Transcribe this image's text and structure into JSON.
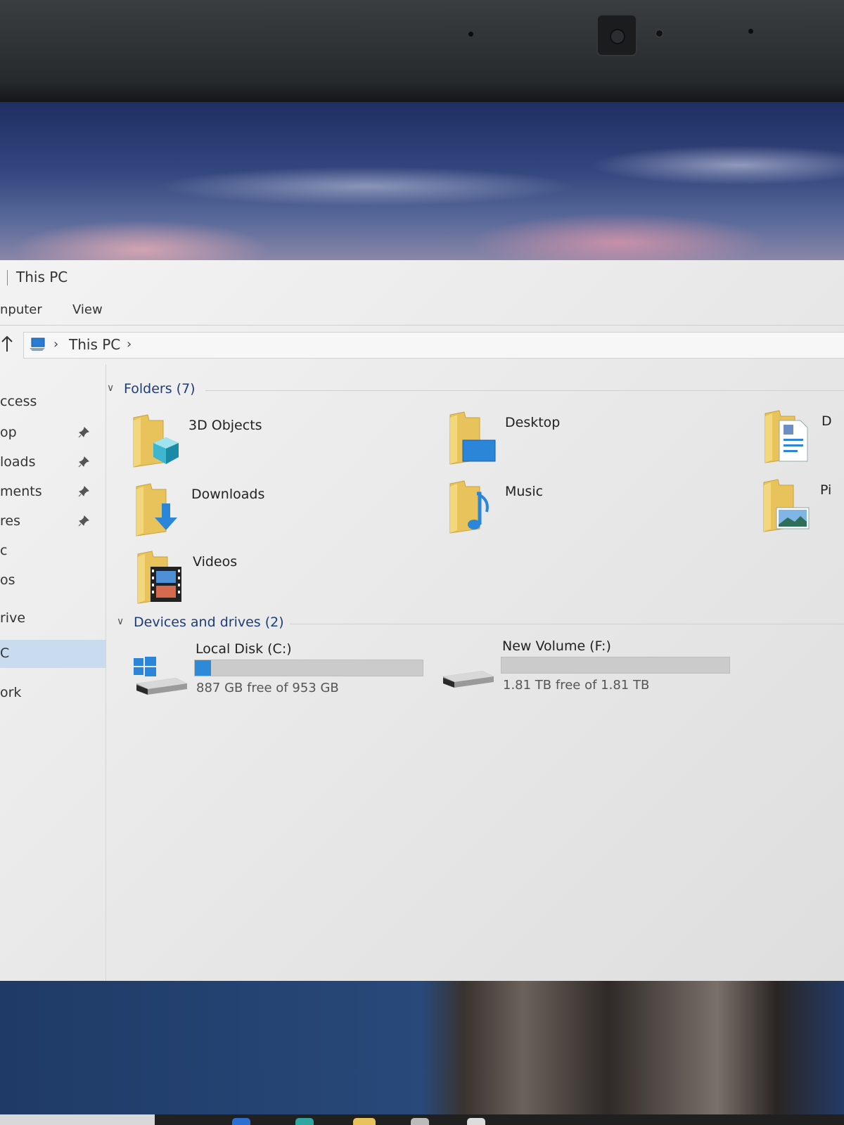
{
  "window": {
    "title": "This PC"
  },
  "ribbon": {
    "tab_computer": "nputer",
    "tab_view": "View"
  },
  "address": {
    "crumb": "This PC",
    "sep1": "›",
    "sep2": "›"
  },
  "nav": {
    "items": [
      {
        "label": "ccess"
      },
      {
        "label": "op",
        "pinned": true
      },
      {
        "label": "loads",
        "pinned": true
      },
      {
        "label": "ments",
        "pinned": true
      },
      {
        "label": "res",
        "pinned": true
      },
      {
        "label": "c"
      },
      {
        "label": "os"
      },
      {
        "label": "rive"
      },
      {
        "label": "C",
        "selected": true
      },
      {
        "label": "ork"
      }
    ]
  },
  "folders": {
    "header": "Folders (7)",
    "items": [
      {
        "label": "3D Objects",
        "icon": "3d-objects-folder-icon"
      },
      {
        "label": "Desktop",
        "icon": "desktop-folder-icon"
      },
      {
        "label": "D",
        "icon": "documents-folder-icon"
      },
      {
        "label": "Downloads",
        "icon": "downloads-folder-icon"
      },
      {
        "label": "Music",
        "icon": "music-folder-icon"
      },
      {
        "label": "Pi",
        "icon": "pictures-folder-icon"
      },
      {
        "label": "Videos",
        "icon": "videos-folder-icon"
      }
    ]
  },
  "drives": {
    "header": "Devices and drives (2)",
    "items": [
      {
        "name": "Local Disk (C:)",
        "free": "887 GB free of 953 GB",
        "used_fraction": 0.07,
        "icon": "windows-drive-icon"
      },
      {
        "name": "New Volume (F:)",
        "free": "1.81 TB free of 1.81 TB",
        "used_fraction": 0.0,
        "icon": "hard-drive-icon"
      }
    ]
  },
  "colors": {
    "accent": "#2d8ad8",
    "folder": "#e8c25a",
    "selection": "#c9dcef"
  }
}
